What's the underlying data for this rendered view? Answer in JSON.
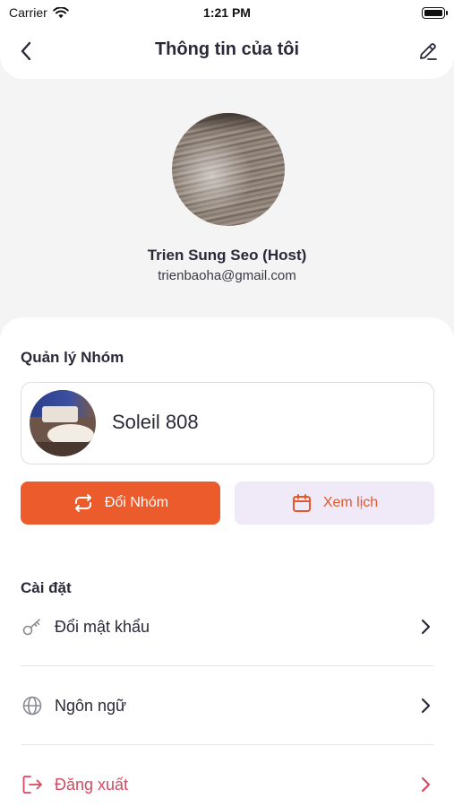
{
  "status_bar": {
    "carrier": "Carrier",
    "time": "1:21 PM"
  },
  "header": {
    "title": "Thông tin của tôi",
    "back_icon": "chevron-left-icon",
    "edit_icon": "pencil-icon"
  },
  "profile": {
    "name": "Trien Sung Seo (Host)",
    "email": "trienbaoha@gmail.com"
  },
  "group_section": {
    "title": "Quản lý Nhóm",
    "group_name": "Soleil 808",
    "switch_button": "Đổi Nhóm",
    "calendar_button": "Xem lịch"
  },
  "settings": {
    "title": "Cài đặt",
    "items": [
      {
        "label": "Đổi mật khẩu",
        "icon": "key-icon"
      },
      {
        "label": "Ngôn ngữ",
        "icon": "globe-icon"
      },
      {
        "label": "Đăng xuất",
        "icon": "logout-icon"
      }
    ]
  },
  "colors": {
    "accent": "#EB5B2B",
    "secondary_bg": "#EFE9F8",
    "logout": "#D9485F",
    "text": "#2B2838"
  }
}
